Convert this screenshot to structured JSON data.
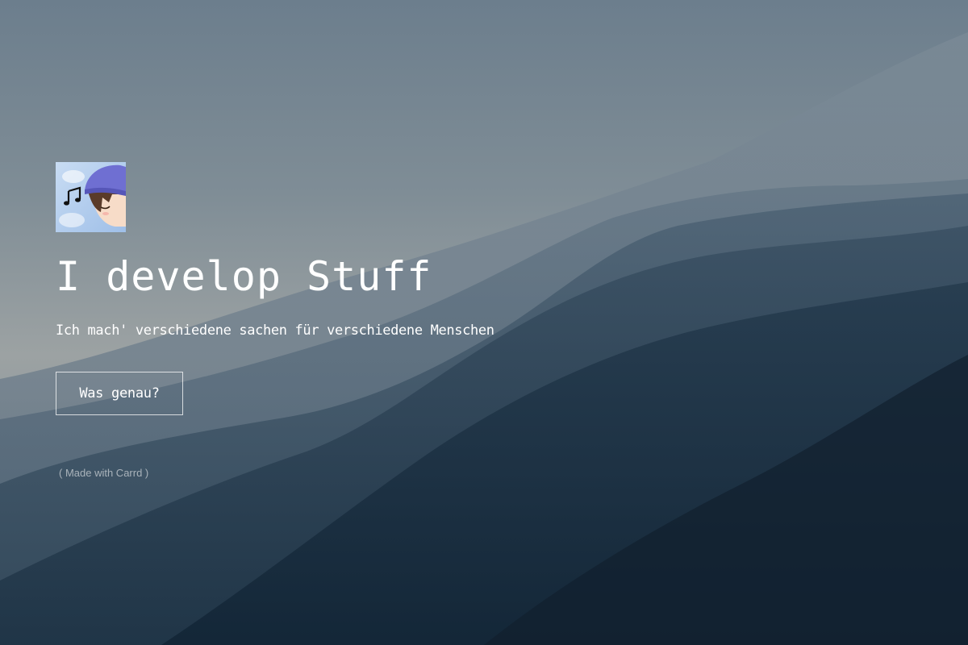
{
  "hero": {
    "title": "I develop Stuff",
    "subtitle": "Ich mach' verschiedene sachen für verschiedene Menschen",
    "cta_label": "Was genau?"
  },
  "footer": {
    "credit": "( Made with Carrd )"
  },
  "avatar": {
    "icon": "anime-boy-with-beanie-and-music-note-icon"
  },
  "colors": {
    "text": "#ffffff",
    "sky_top": "#6b7d8c",
    "haze": "#9ea4a5",
    "mountain_dark": "#16293a"
  }
}
